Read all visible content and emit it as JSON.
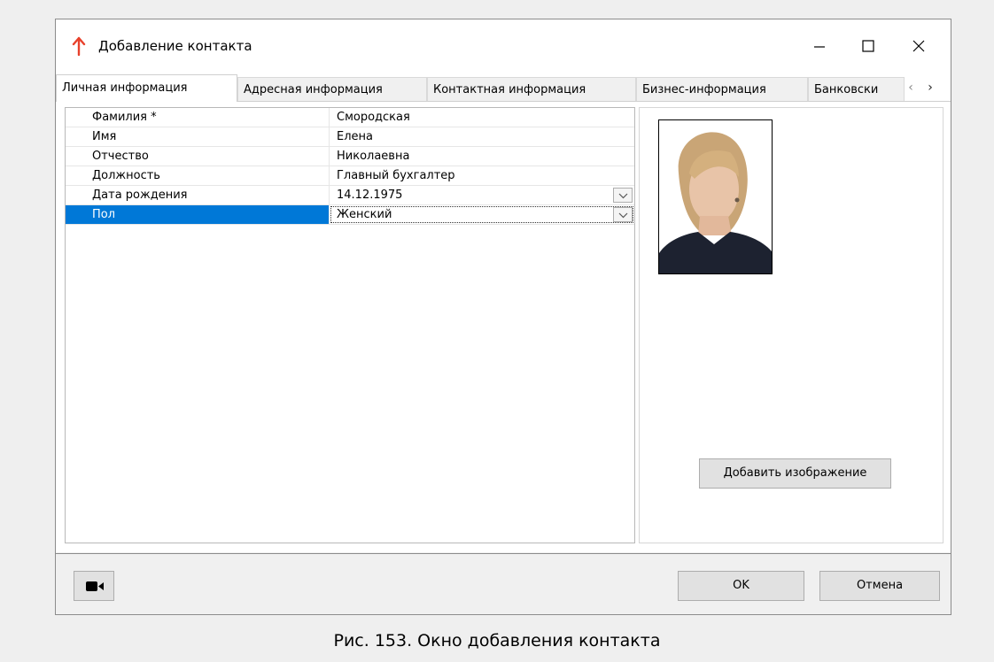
{
  "window": {
    "title": "Добавление контакта",
    "accent_color": "#e8412b"
  },
  "tabs": [
    {
      "label": "Личная информация",
      "active": true
    },
    {
      "label": "Адресная информация"
    },
    {
      "label": "Контактная информация"
    },
    {
      "label": "Бизнес-информация"
    },
    {
      "label": "Банковски"
    }
  ],
  "tab_scroll": {
    "left": "‹",
    "right": "›"
  },
  "fields": [
    {
      "name": "Фамилия *",
      "value": "Смородская"
    },
    {
      "name": "Имя",
      "value": "Елена"
    },
    {
      "name": "Отчество",
      "value": "Николаевна"
    },
    {
      "name": "Должность",
      "value": "Главный бухгалтер"
    },
    {
      "name": "Дата рождения",
      "value": "14.12.1975",
      "dropdown": true
    },
    {
      "name": "Пол",
      "value": "Женский",
      "dropdown": true,
      "selected": true
    }
  ],
  "photo": {
    "add_button": "Добавить изображение"
  },
  "footer": {
    "ok": "OK",
    "cancel": "Отмена"
  },
  "caption": "Рис. 153. Окно добавления контакта"
}
